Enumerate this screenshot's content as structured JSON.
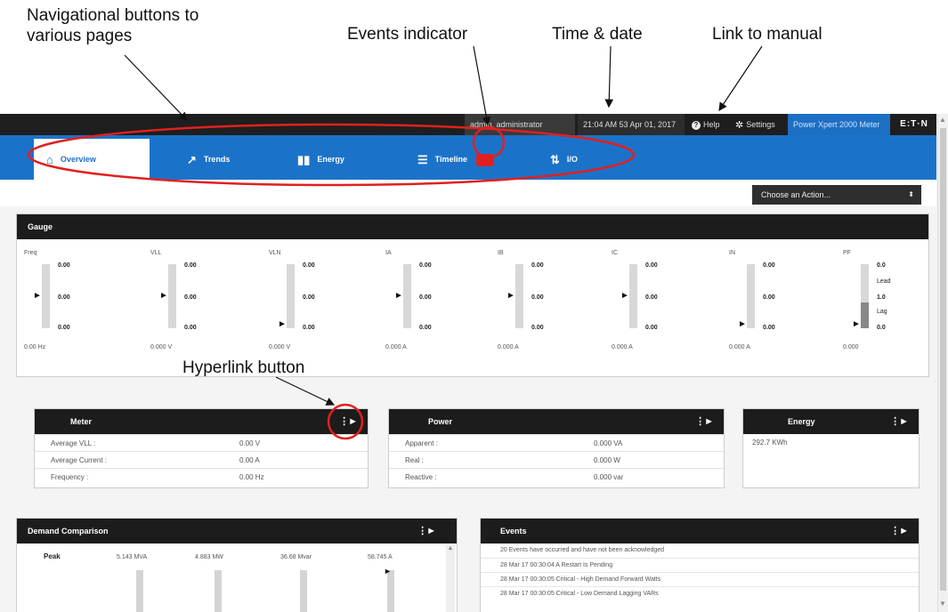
{
  "annotations": {
    "nav_buttons": "Navigational buttons to\nvarious pages",
    "events_indicator": "Events indicator",
    "time_date": "Time & date",
    "manual_link": "Link to manual",
    "hyperlink_button": "Hyperlink button"
  },
  "topbar": {
    "user": "admin, administrator",
    "time": "21:04 AM 53 Apr 01, 2017",
    "help": "Help",
    "settings": "Settings",
    "meter": "Power Xpert 2000 Meter",
    "brand": "E:T·N"
  },
  "nav": {
    "tabs": [
      {
        "label": "Overview",
        "icon": "home-icon",
        "active": true
      },
      {
        "label": "Trends",
        "icon": "trend-icon",
        "active": false
      },
      {
        "label": "Energy",
        "icon": "bar-chart-icon",
        "active": false
      },
      {
        "label": "Timeline",
        "icon": "list-icon",
        "active": false
      },
      {
        "label": "I/O",
        "icon": "io-icon",
        "active": false
      }
    ]
  },
  "action_select": {
    "value": "Choose an Action..."
  },
  "gauge": {
    "title": "Gauge",
    "items": [
      {
        "name": "Freq",
        "top": "0.00",
        "mid": "0.00",
        "bot": "0.00",
        "reading": "0.00 Hz"
      },
      {
        "name": "VLL",
        "top": "0.00",
        "mid": "0.00",
        "bot": "0.00",
        "reading": "0.000 V"
      },
      {
        "name": "VLN",
        "top": "0.00",
        "mid": "0.00",
        "bot": "0.00",
        "reading": "0.000 V"
      },
      {
        "name": "IA",
        "top": "0.00",
        "mid": "0.00",
        "bot": "0.00",
        "reading": "0.000 A"
      },
      {
        "name": "IB",
        "top": "0.00",
        "mid": "0.00",
        "bot": "0.00",
        "reading": "0.000 A"
      },
      {
        "name": "IC",
        "top": "0.00",
        "mid": "0.00",
        "bot": "0.00",
        "reading": "0.000 A"
      },
      {
        "name": "IN",
        "top": "0.00",
        "mid": "0.00",
        "bot": "0.00",
        "reading": "0.000 A"
      },
      {
        "name": "PF",
        "top": "0.0",
        "mid": "1.0",
        "bot": "0.0",
        "reading": "0.000",
        "lead": "Lead",
        "lag": "Lag"
      }
    ]
  },
  "meter": {
    "title": "Meter",
    "rows": [
      {
        "label": "Average VLL :",
        "value": "0.00 V"
      },
      {
        "label": "Average Current :",
        "value": "0.00 A"
      },
      {
        "label": "Frequency :",
        "value": "0.00 Hz"
      }
    ]
  },
  "power": {
    "title": "Power",
    "rows": [
      {
        "label": "Apparent :",
        "value": "0.000 VA"
      },
      {
        "label": "Real :",
        "value": "0.000 W"
      },
      {
        "label": "Reactive :",
        "value": "0.000 var"
      }
    ]
  },
  "energy": {
    "title": "Energy",
    "value": "292.7 KWh"
  },
  "demand": {
    "title": "Demand Comparison",
    "peak_label": "Peak",
    "columns": [
      "5.143 MVA",
      "4.883 MW",
      "36.68 Mvar",
      "58.745 A"
    ]
  },
  "events": {
    "title": "Events",
    "rows": [
      "20 Events have occurred and have not been acknowledged",
      "28 Mar 17 00:30:04 A Restart Is Pending",
      "28 Mar 17 00:30:05 Critical - High Demand Forward Watts",
      "28 Mar 17 00:30:05 Critical - Low Demand Lagging VARs"
    ]
  },
  "colors": {
    "accent": "#1b73c9",
    "callout": "#e02020",
    "header": "#1c1c1c"
  }
}
